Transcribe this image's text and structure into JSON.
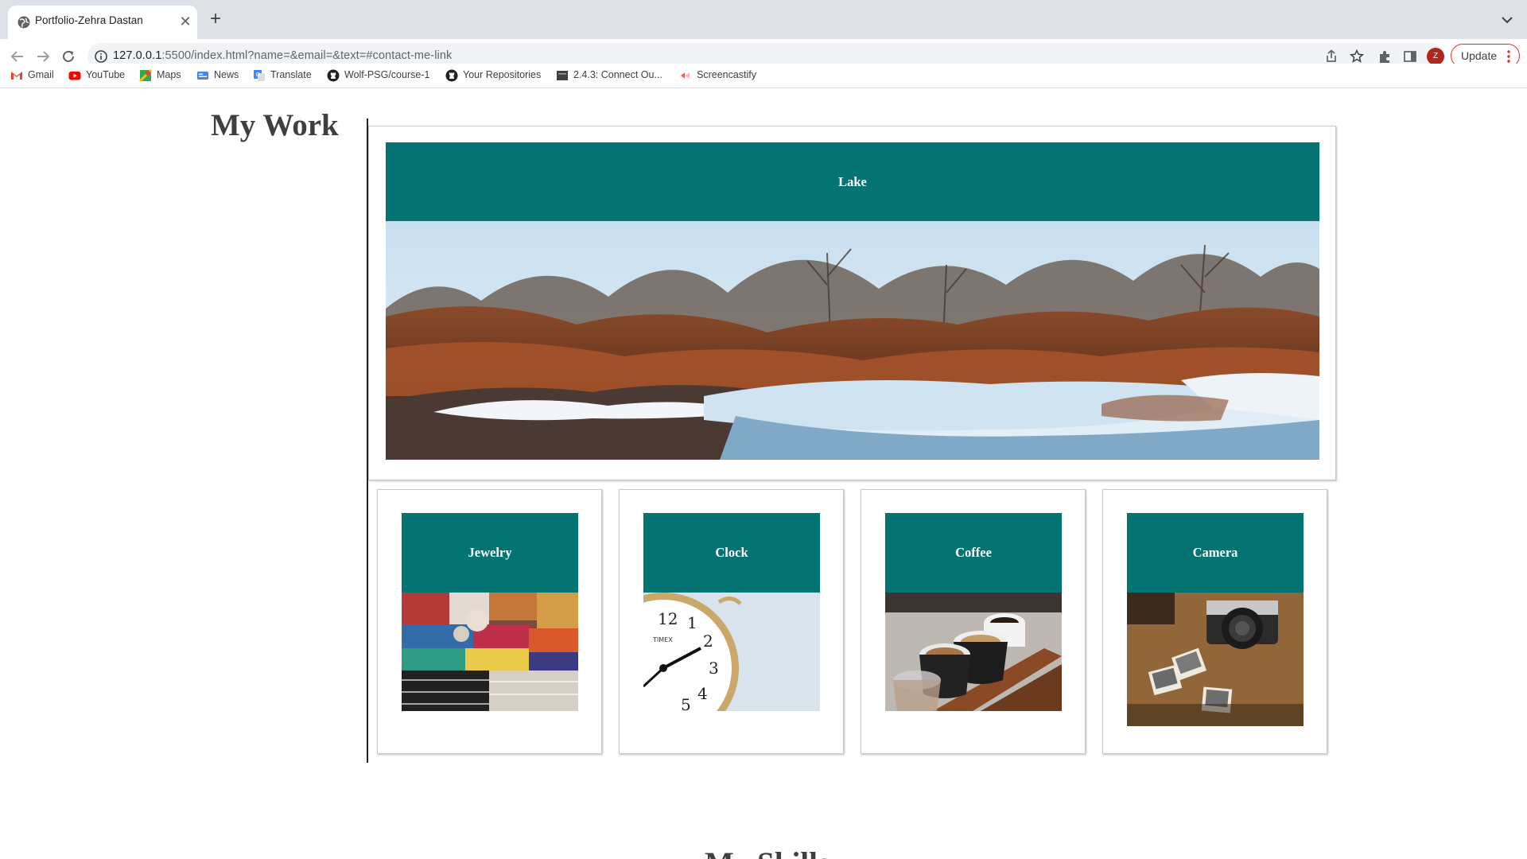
{
  "browser": {
    "tab": {
      "title": "Portfolio-Zehra Dastan"
    },
    "omnibox": {
      "url_host": "127.0.0.1",
      "url_rest": ":5500/index.html?name=&email=&text=#contact-me-link"
    },
    "avatar_letter": "Z",
    "update_label": "Update",
    "bookmarks": [
      {
        "label": "Gmail",
        "icon": "gmail-icon"
      },
      {
        "label": "YouTube",
        "icon": "youtube-icon"
      },
      {
        "label": "Maps",
        "icon": "maps-icon"
      },
      {
        "label": "News",
        "icon": "news-icon"
      },
      {
        "label": "Translate",
        "icon": "translate-icon"
      },
      {
        "label": "Wolf-PSG/course-1",
        "icon": "github-icon"
      },
      {
        "label": "Your Repositories",
        "icon": "github-icon"
      },
      {
        "label": "2.4.3: Connect Ou...",
        "icon": "course-icon"
      },
      {
        "label": "Screencastify",
        "icon": "screencastify-icon"
      }
    ]
  },
  "page": {
    "section_title": "My Work",
    "next_section_title": "My Skills",
    "colors": {
      "card_header": "#047473",
      "title_text": "#3f3f3f"
    },
    "featured": {
      "title": "Lake",
      "image": "winter lake with snow and reeds"
    },
    "projects": [
      {
        "title": "Jewelry",
        "image": "colorful woven bracelets"
      },
      {
        "title": "Clock",
        "image": "vintage alarm clock"
      },
      {
        "title": "Coffee",
        "image": "coffee cups on a tray"
      },
      {
        "title": "Camera",
        "image": "vintage camera and photos"
      }
    ]
  }
}
